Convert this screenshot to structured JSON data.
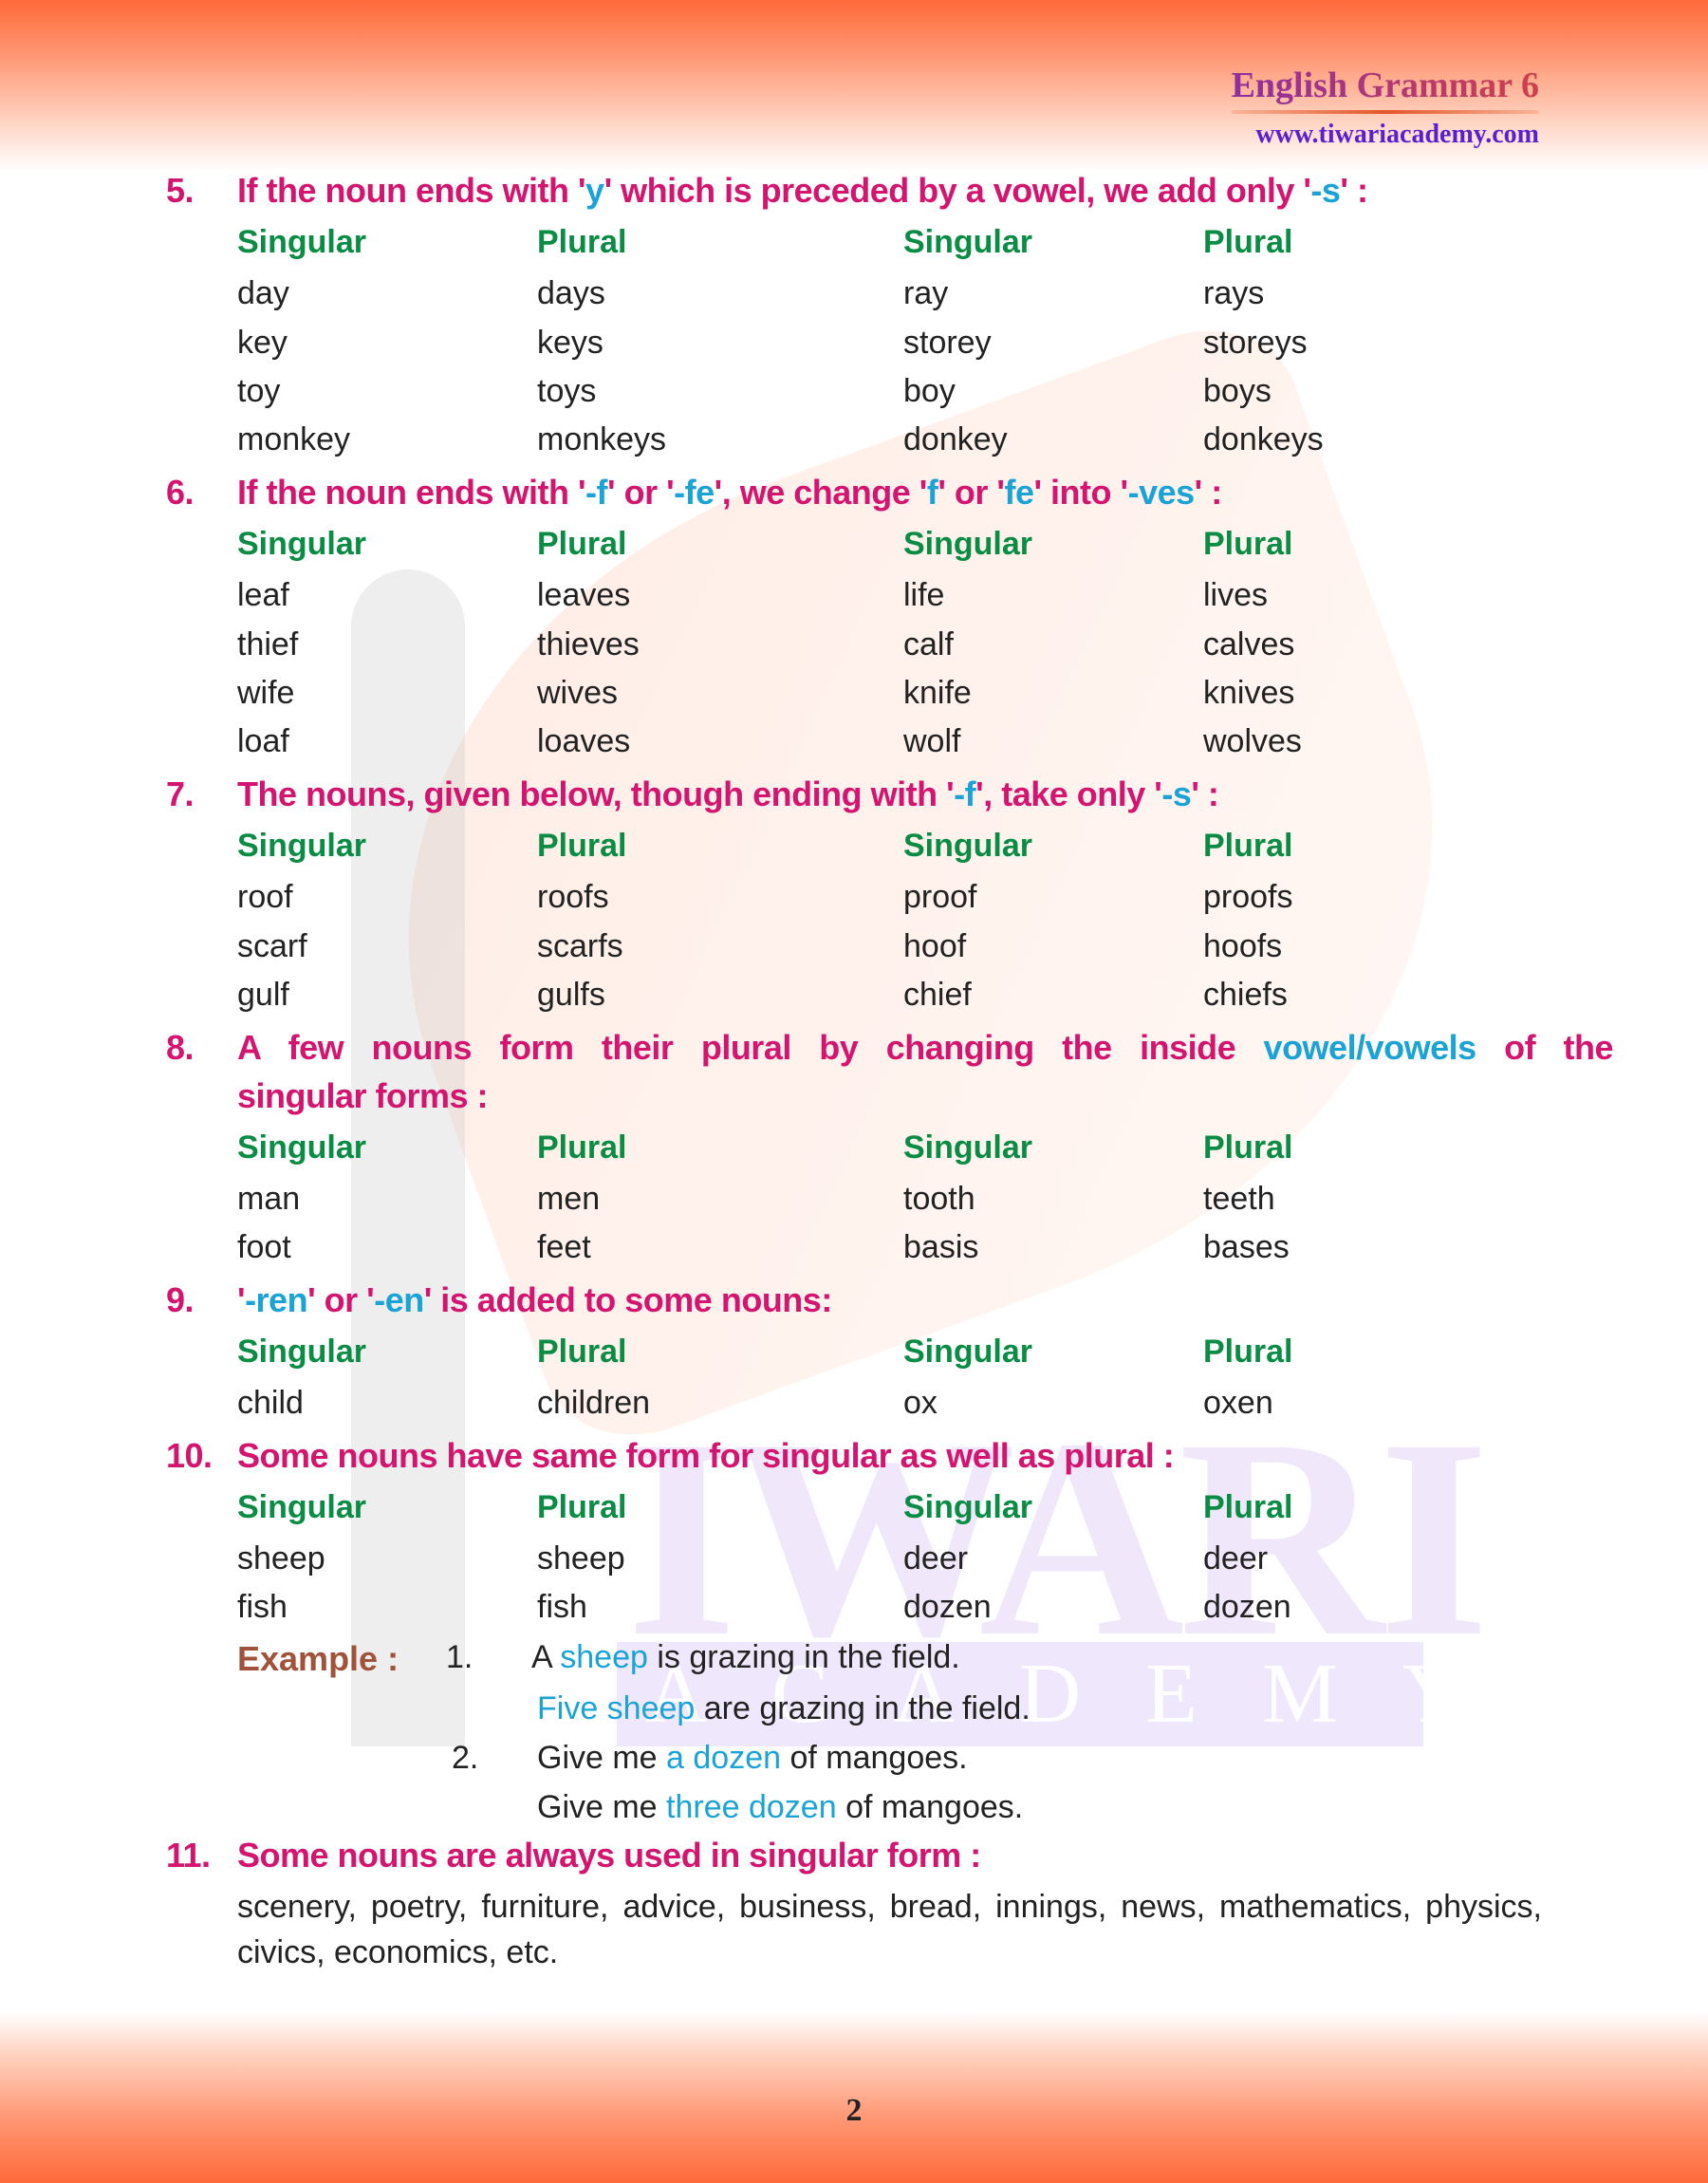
{
  "header": {
    "book_title": "English Grammar 6",
    "site_url": "www.tiwariacademy.com"
  },
  "watermark": {
    "word1": "IWARI",
    "word2": "ACADEMY"
  },
  "colors": {
    "heading": "#d4156f",
    "highlight": "#1ba3d6",
    "column_header": "#0b8c45",
    "example_label": "#a0523a",
    "url": "#5b1fd0"
  },
  "columns": {
    "singular": "Singular",
    "plural": "Plural"
  },
  "sections": [
    {
      "num": "5.",
      "parts": [
        {
          "t": "If the noun ends with '"
        },
        {
          "t": "y",
          "hl": true
        },
        {
          "t": "' which is preceded by a vowel, we add only '"
        },
        {
          "t": "-s",
          "hl": true
        },
        {
          "t": "' :"
        }
      ],
      "rows": [
        [
          "day",
          "days",
          "ray",
          "rays"
        ],
        [
          "key",
          "keys",
          "storey",
          "storeys"
        ],
        [
          "toy",
          "toys",
          "boy",
          "boys"
        ],
        [
          "monkey",
          "monkeys",
          "donkey",
          "donkeys"
        ]
      ]
    },
    {
      "num": "6.",
      "parts": [
        {
          "t": "If the noun ends with '"
        },
        {
          "t": "-f",
          "hl": true
        },
        {
          "t": "' or '"
        },
        {
          "t": "-fe",
          "hl": true
        },
        {
          "t": "', we change '"
        },
        {
          "t": "f",
          "hl": true
        },
        {
          "t": "' or '"
        },
        {
          "t": "fe",
          "hl": true
        },
        {
          "t": "' into '"
        },
        {
          "t": "-ves",
          "hl": true
        },
        {
          "t": "' :"
        }
      ],
      "rows": [
        [
          "leaf",
          "leaves",
          "life",
          "lives"
        ],
        [
          "thief",
          "thieves",
          "calf",
          "calves"
        ],
        [
          "wife",
          "wives",
          "knife",
          "knives"
        ],
        [
          "loaf",
          "loaves",
          "wolf",
          "wolves"
        ]
      ]
    },
    {
      "num": "7.",
      "parts": [
        {
          "t": "The nouns, given below, though ending with '"
        },
        {
          "t": "-f",
          "hl": true
        },
        {
          "t": "', take only '"
        },
        {
          "t": "-s",
          "hl": true
        },
        {
          "t": "' :"
        }
      ],
      "rows": [
        [
          "roof",
          "roofs",
          "proof",
          "proofs"
        ],
        [
          "scarf",
          "scarfs",
          "hoof",
          "hoofs"
        ],
        [
          "gulf",
          "gulfs",
          "chief",
          "chiefs"
        ]
      ]
    },
    {
      "num": "8.",
      "line1_parts": [
        {
          "t": "A few nouns form their plural by changing the inside "
        },
        {
          "t": "vowel/vowels",
          "hl": true
        },
        {
          "t": " of the"
        }
      ],
      "line2": "singular forms :",
      "rows": [
        [
          "man",
          "men",
          "tooth",
          "teeth"
        ],
        [
          "foot",
          "feet",
          "basis",
          "bases"
        ]
      ]
    },
    {
      "num": "9.",
      "parts": [
        {
          "t": "'"
        },
        {
          "t": "-ren",
          "hl": true
        },
        {
          "t": "' or '"
        },
        {
          "t": "-en",
          "hl": true
        },
        {
          "t": "' is added to some nouns:"
        }
      ],
      "rows": [
        [
          "child",
          "children",
          "ox",
          "oxen"
        ]
      ]
    },
    {
      "num": "10.",
      "parts": [
        {
          "t": "Some nouns have same form for singular as well as plural :"
        }
      ],
      "rows": [
        [
          "sheep",
          "sheep",
          "deer",
          "deer"
        ],
        [
          "fish",
          "fish",
          "dozen",
          "dozen"
        ]
      ],
      "example": {
        "label": "Example :",
        "items": [
          {
            "num": "1.",
            "lines": [
              [
                {
                  "t": "A "
                },
                {
                  "t": "sheep",
                  "hl": true
                },
                {
                  "t": " is grazing in the field."
                }
              ],
              [
                {
                  "t": "Five sheep",
                  "hl": true
                },
                {
                  "t": " are grazing in the field."
                }
              ]
            ]
          },
          {
            "num": "2.",
            "lines": [
              [
                {
                  "t": "Give me "
                },
                {
                  "t": "a dozen",
                  "hl": true
                },
                {
                  "t": " of mangoes."
                }
              ],
              [
                {
                  "t": "Give me "
                },
                {
                  "t": "three dozen",
                  "hl": true
                },
                {
                  "t": " of mangoes."
                }
              ]
            ]
          }
        ]
      }
    },
    {
      "num": "11.",
      "parts": [
        {
          "t": "Some nouns are always used in singular form :"
        }
      ],
      "text_line1": "scenery, poetry, furniture, advice, business, bread, innings, news, mathematics, physics,",
      "text_line2": "civics, economics, etc."
    }
  ],
  "page_number": "2"
}
